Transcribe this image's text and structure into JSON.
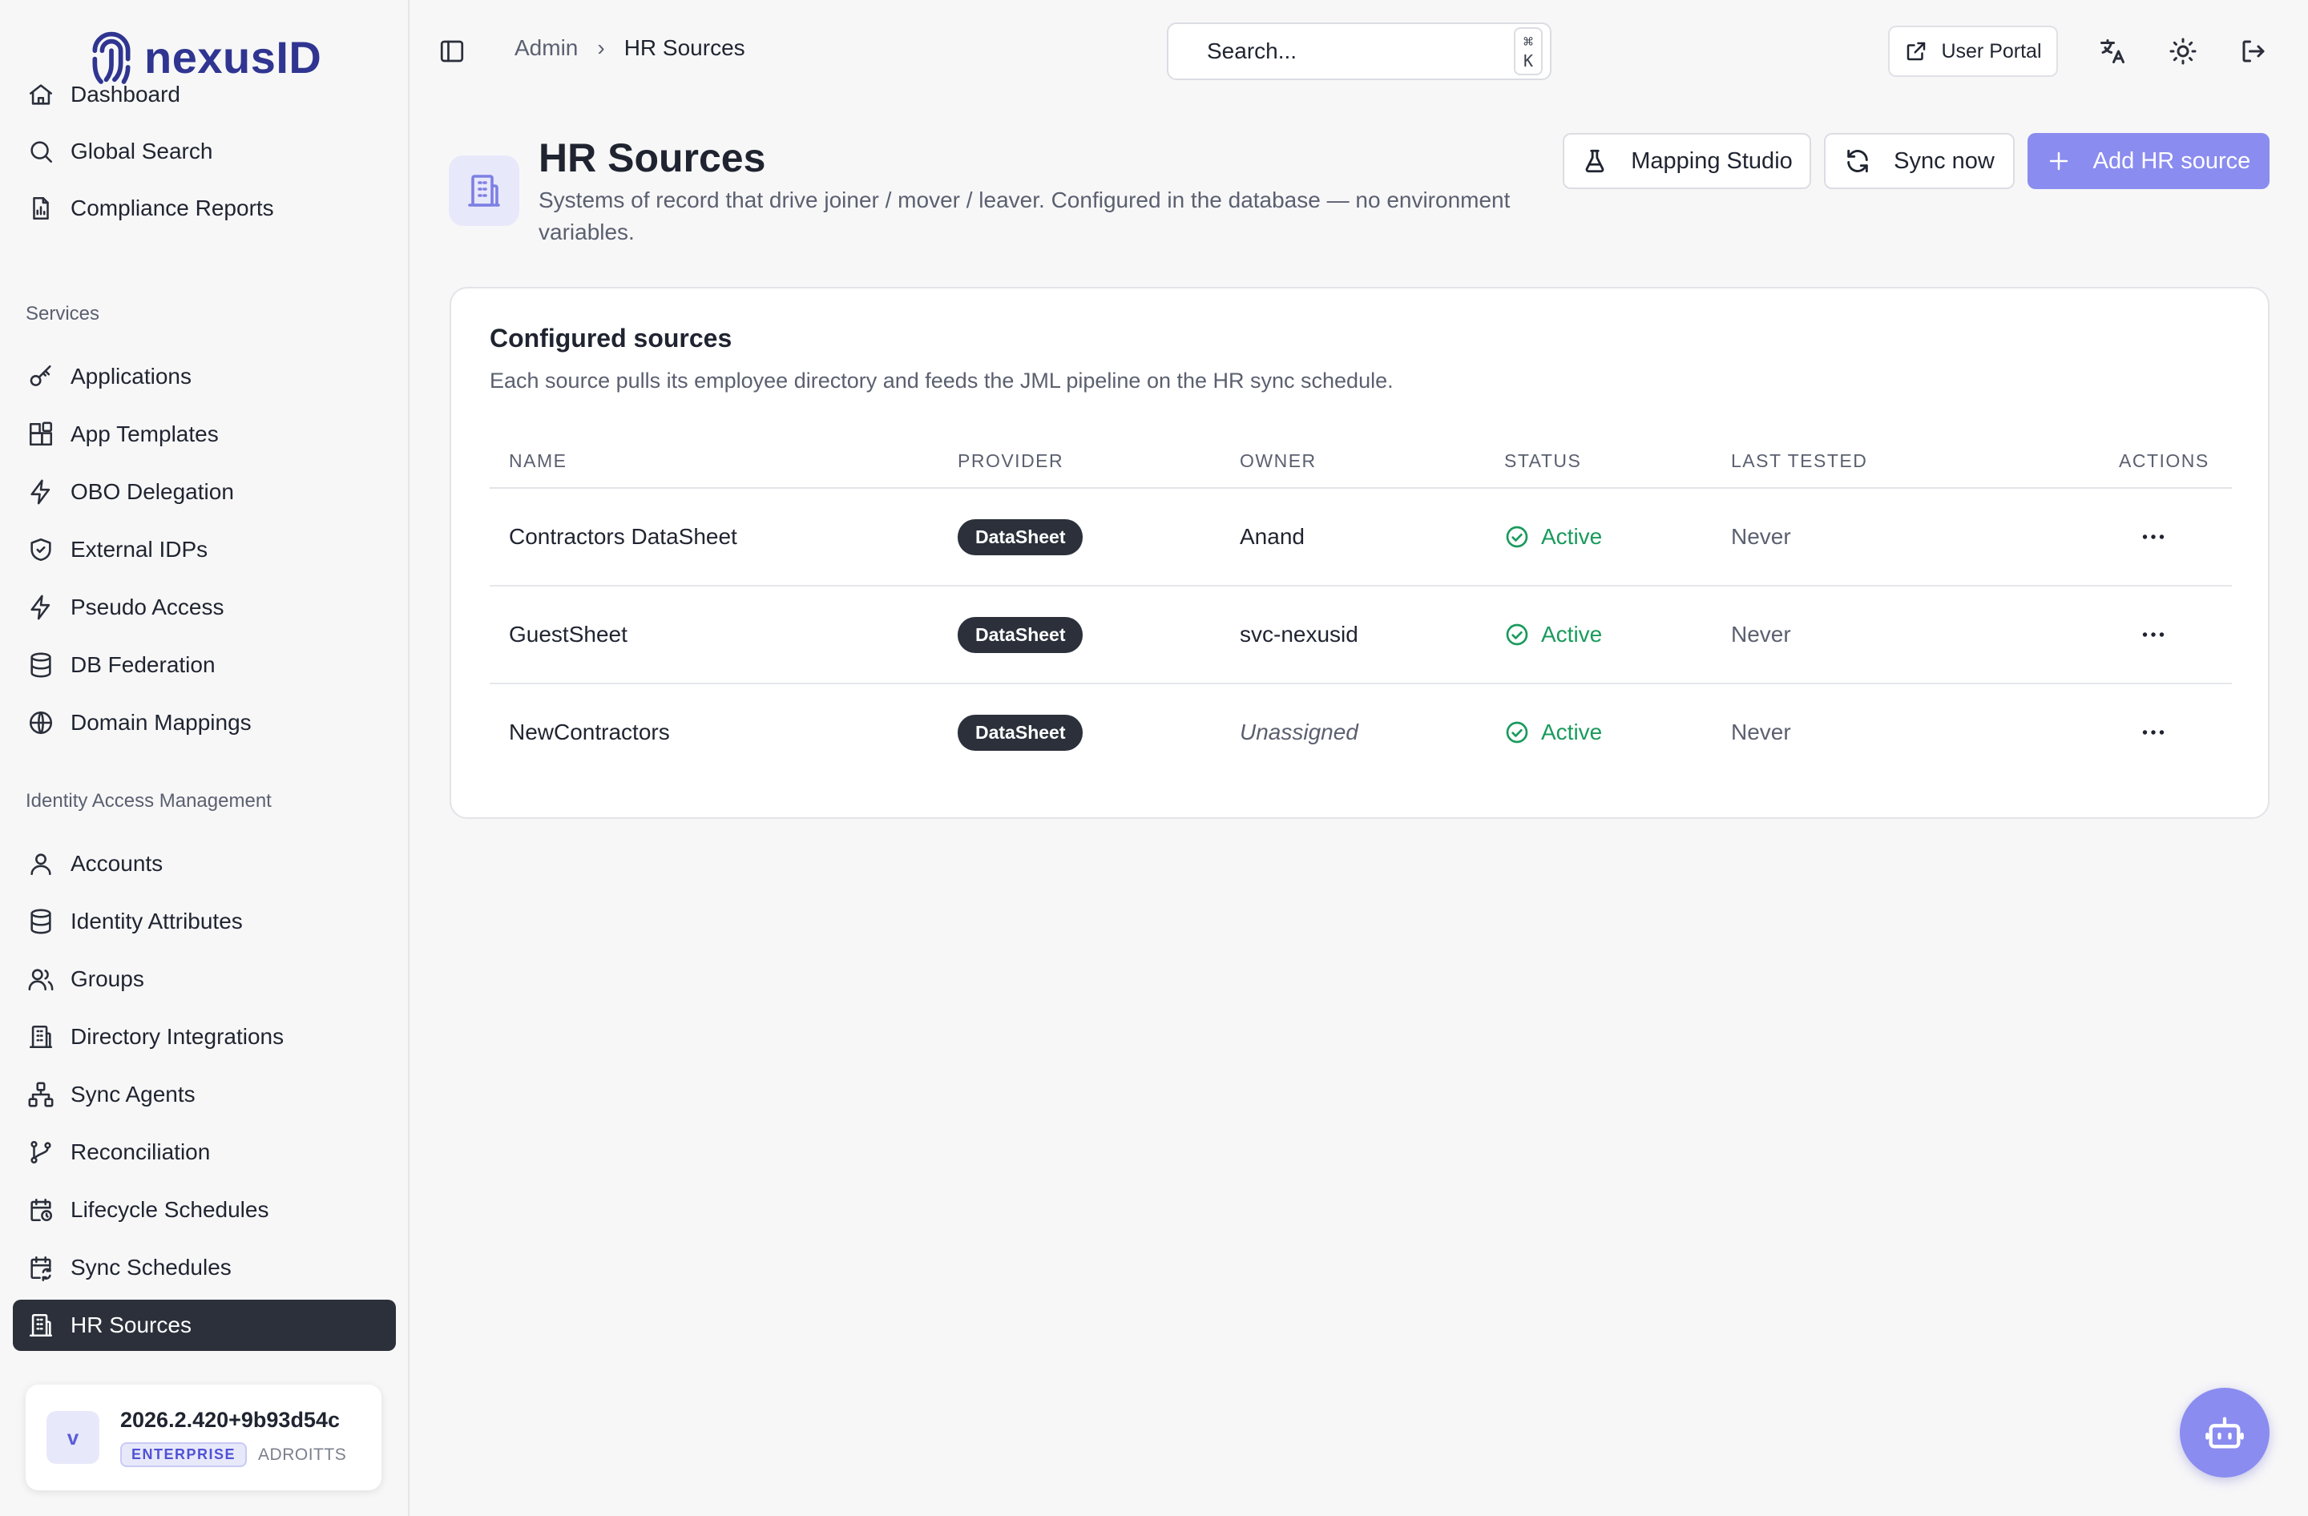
{
  "brand": {
    "name": "nexusID"
  },
  "sidebar": {
    "top_items": [
      {
        "label": "Dashboard",
        "icon": "home-icon"
      },
      {
        "label": "Global Search",
        "icon": "search-icon"
      },
      {
        "label": "Compliance Reports",
        "icon": "report-icon"
      }
    ],
    "sections": [
      {
        "title": "Services",
        "items": [
          {
            "label": "Applications",
            "icon": "key-icon"
          },
          {
            "label": "App Templates",
            "icon": "blocks-icon"
          },
          {
            "label": "OBO Delegation",
            "icon": "bolt-icon"
          },
          {
            "label": "External IDPs",
            "icon": "shield-icon"
          },
          {
            "label": "Pseudo Access",
            "icon": "bolt-icon"
          },
          {
            "label": "DB Federation",
            "icon": "database-icon"
          },
          {
            "label": "Domain Mappings",
            "icon": "globe-icon"
          }
        ]
      },
      {
        "title": "Identity Access Management",
        "items": [
          {
            "label": "Accounts",
            "icon": "user-icon"
          },
          {
            "label": "Identity Attributes",
            "icon": "database-icon"
          },
          {
            "label": "Groups",
            "icon": "users-icon"
          },
          {
            "label": "Directory Integrations",
            "icon": "building-icon"
          },
          {
            "label": "Sync Agents",
            "icon": "network-icon"
          },
          {
            "label": "Reconciliation",
            "icon": "git-branch-icon"
          },
          {
            "label": "Lifecycle Schedules",
            "icon": "calendar-clock-icon"
          },
          {
            "label": "Sync Schedules",
            "icon": "calendar-sync-icon"
          },
          {
            "label": "HR Sources",
            "icon": "building-icon",
            "active": true
          }
        ]
      }
    ],
    "version": {
      "avatar": "v",
      "number": "2026.2.420+9b93d54c",
      "edition": "ENTERPRISE",
      "org": "ADROITTS"
    }
  },
  "topbar": {
    "breadcrumb": {
      "parent": "Admin",
      "separator": "›",
      "current": "HR Sources"
    },
    "search": {
      "placeholder": "Search...",
      "shortcut": "⌘ K"
    },
    "user_portal_label": "User Portal"
  },
  "page": {
    "title": "HR Sources",
    "subtitle": "Systems of record that drive joiner / mover / leaver. Configured in the database — no environment variables.",
    "buttons": {
      "mapping_studio": "Mapping Studio",
      "sync_now": "Sync now",
      "add_source": "Add HR source"
    }
  },
  "card": {
    "title": "Configured sources",
    "subtitle": "Each source pulls its employee directory and feeds the JML pipeline on the HR sync schedule.",
    "columns": [
      "NAME",
      "PROVIDER",
      "OWNER",
      "STATUS",
      "LAST TESTED",
      "ACTIONS"
    ],
    "rows": [
      {
        "name": "Contractors DataSheet",
        "provider": "DataSheet",
        "owner": "Anand",
        "owner_unassigned": false,
        "status": "Active",
        "last_tested": "Never"
      },
      {
        "name": "GuestSheet",
        "provider": "DataSheet",
        "owner": "svc-nexusid",
        "owner_unassigned": false,
        "status": "Active",
        "last_tested": "Never"
      },
      {
        "name": "NewContractors",
        "provider": "DataSheet",
        "owner": "Unassigned",
        "owner_unassigned": true,
        "status": "Active",
        "last_tested": "Never"
      }
    ]
  },
  "colors": {
    "accent": "#8a8cf0",
    "active_nav": "#2b303b",
    "status_active": "#1a9a5c",
    "brand": "#2f3590"
  }
}
